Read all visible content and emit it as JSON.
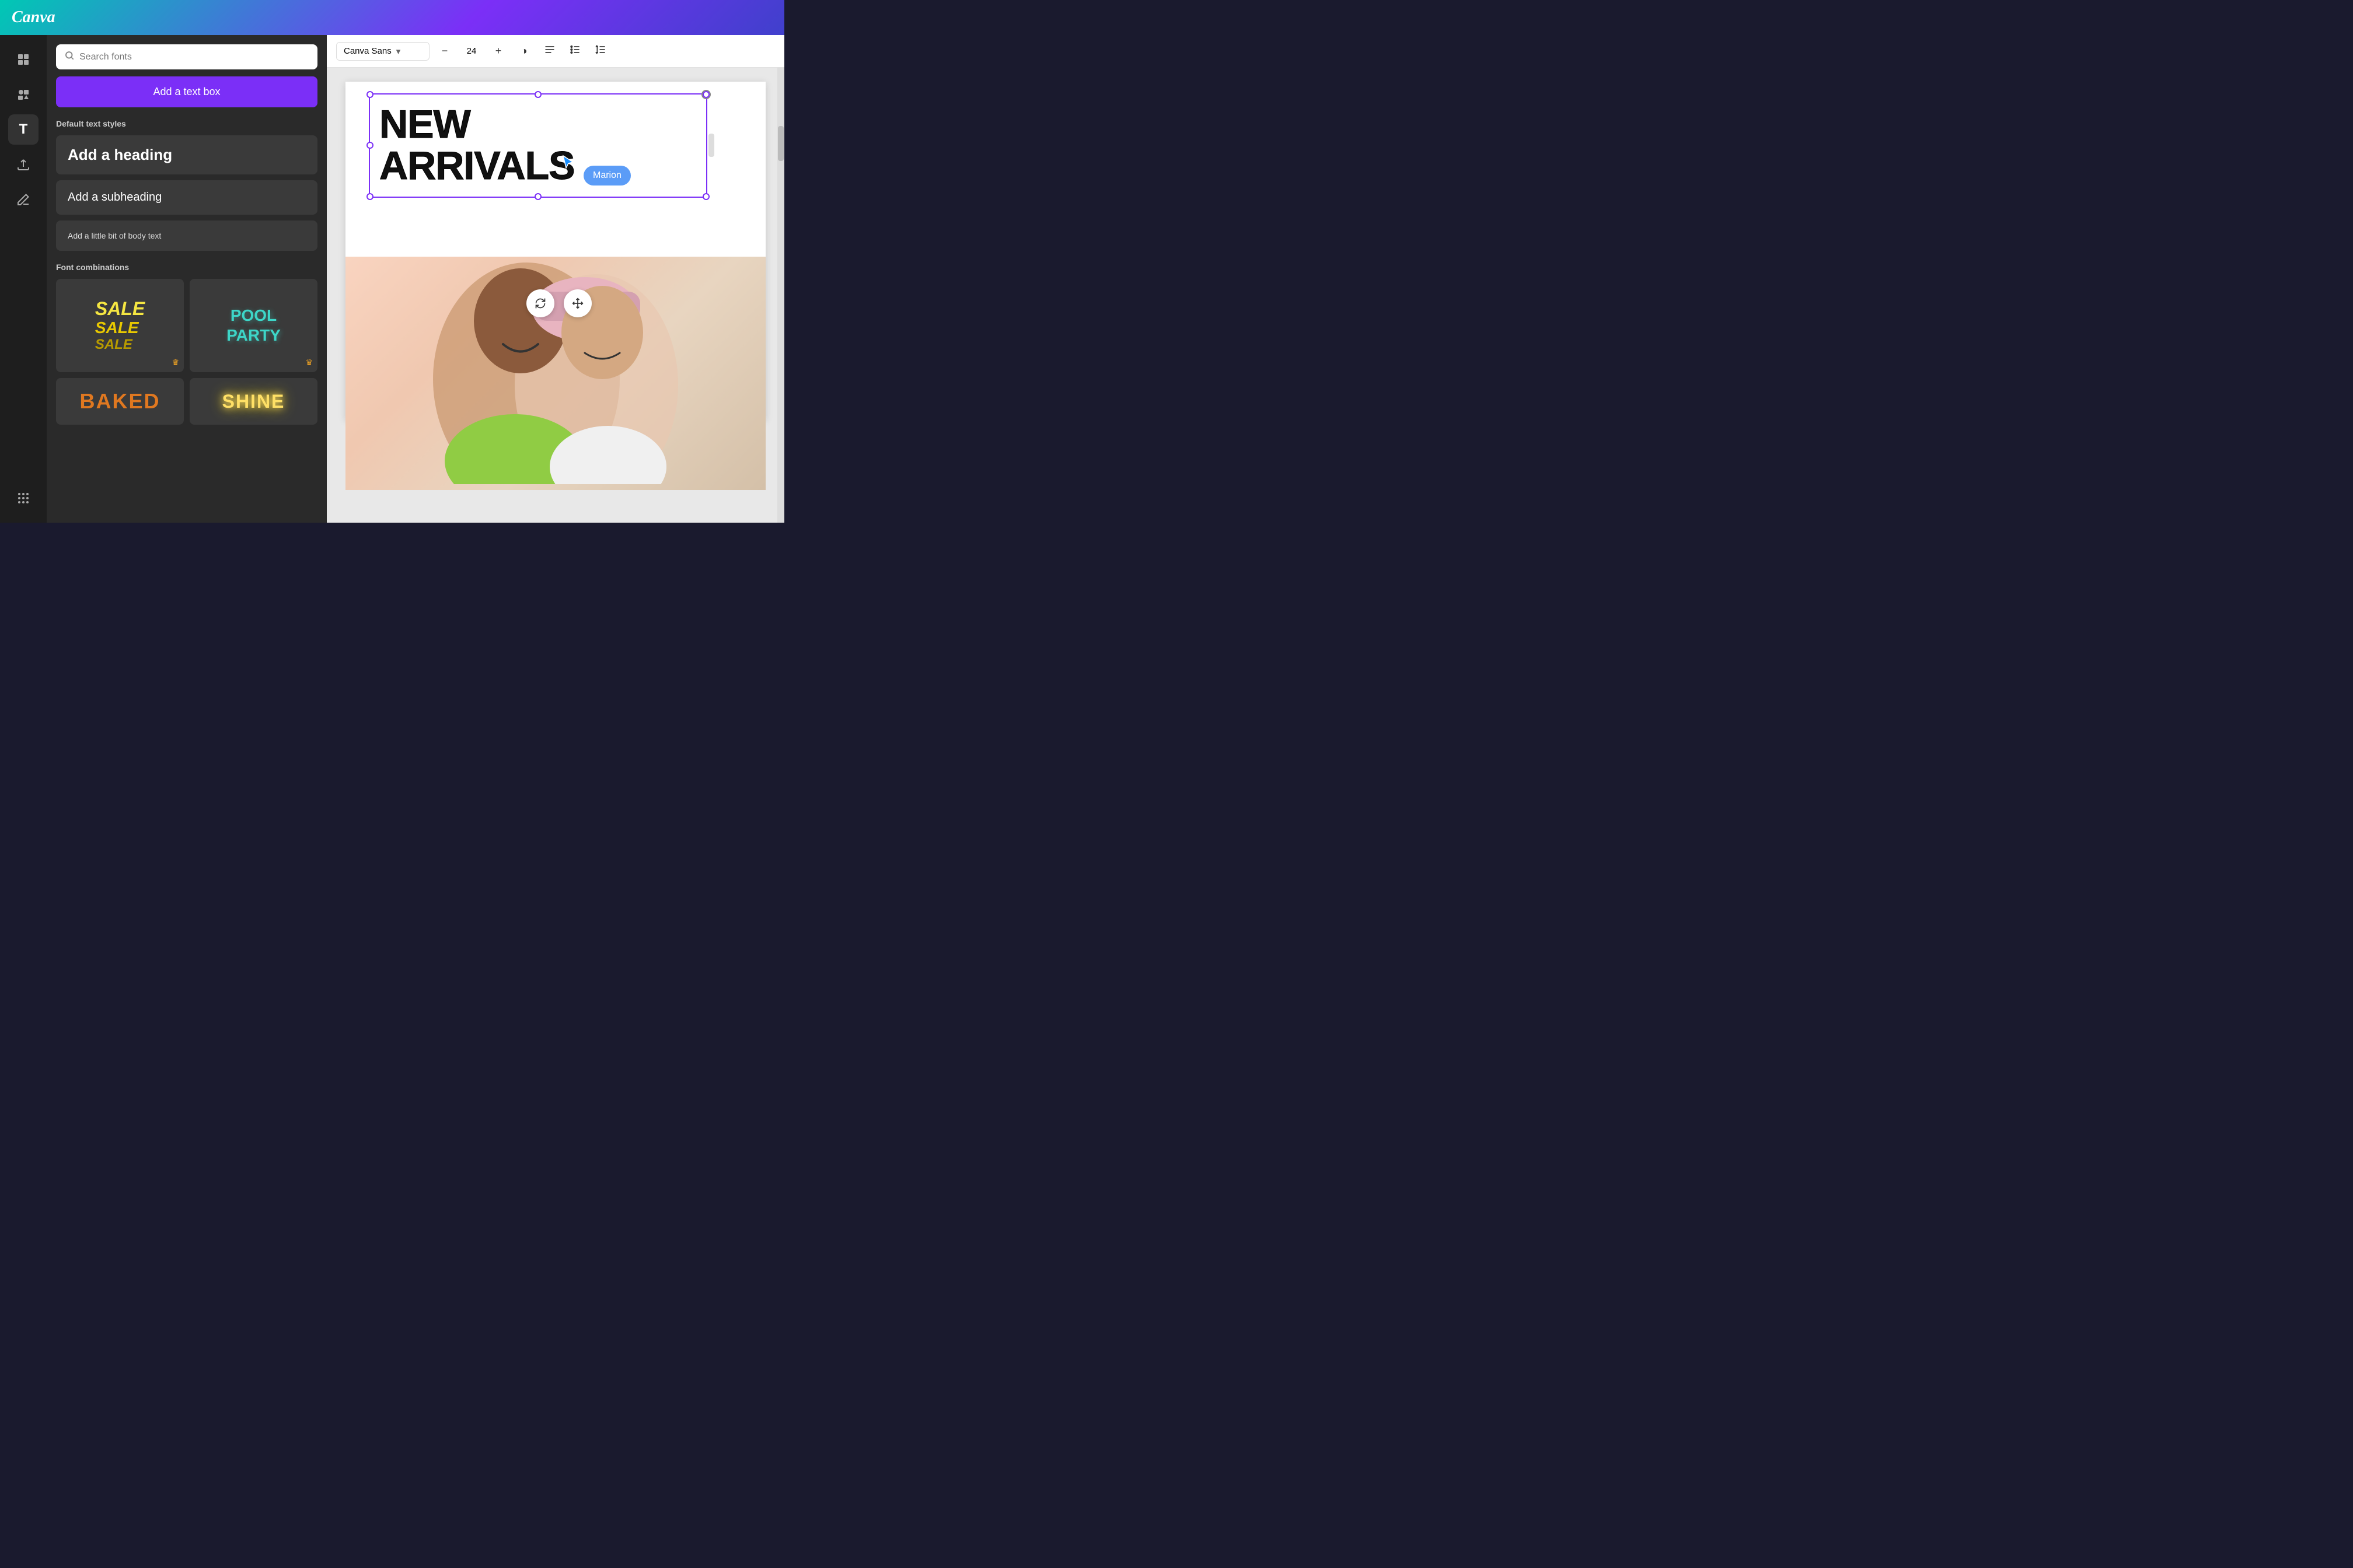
{
  "app": {
    "name": "Canva"
  },
  "header": {
    "logo": "Canva"
  },
  "toolbar": {
    "font_name": "Canva Sans",
    "font_size": "24",
    "font_dropdown_label": "Canva Sans"
  },
  "text_panel": {
    "search_placeholder": "Search fonts",
    "add_textbox_label": "Add a text box",
    "default_styles_title": "Default text styles",
    "heading_label": "Add a heading",
    "subheading_label": "Add a subheading",
    "body_label": "Add a little bit of body text",
    "font_combinations_title": "Font combinations",
    "sale_lines": [
      "SALE",
      "SALE",
      "SALE"
    ],
    "pool_party_lines": [
      "POOL",
      "PARTY"
    ],
    "baked_label": "BAKED",
    "shine_label": "SHINE"
  },
  "canvas": {
    "title_text": "NEW ARRIVALS",
    "tooltip_label": "Marion"
  },
  "icons": {
    "grid": "⊞",
    "elements": "❖",
    "text": "T",
    "upload": "↑",
    "draw": "✏",
    "apps": "⠿",
    "search": "🔍",
    "minus": "−",
    "plus": "+",
    "circle_half": "◑",
    "align_left": "≡",
    "list": "≣",
    "line_spacing": "↕",
    "chevron_down": "∨",
    "rotate": "↻",
    "move": "⊕",
    "crown": "♛"
  }
}
